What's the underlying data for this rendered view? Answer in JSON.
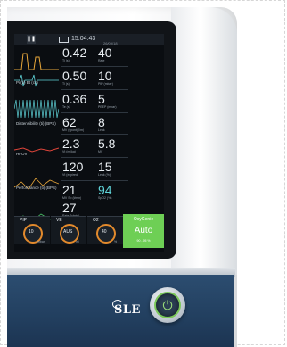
{
  "device": {
    "logo_text": "SLE",
    "power_icon": "power-icon"
  },
  "status_bar": {
    "clock": "15:04:43",
    "date": "26/09/18"
  },
  "wave_labels": [
    "Pi  (ti)  Bt  (cc)",
    "Distensibility  (ti)  (BPS)",
    "HFOV",
    "Performance  (ti)  (BPS)"
  ],
  "readings": [
    {
      "value_a": "0.42",
      "value_b": "40",
      "label_a": "Ti (s)",
      "label_b": "Rate"
    },
    {
      "value_a": "0.50",
      "value_b": "10",
      "label_a": "Ti (s)",
      "label_b": "PIP (mbar)"
    },
    {
      "value_a": "0.36",
      "value_b": "5",
      "label_a": "Te (s)",
      "label_b": "PEEP (mbar)"
    },
    {
      "value_a": "62",
      "value_b": "8",
      "label_a": "MV (spont)(l/m)",
      "label_b": "Leak"
    },
    {
      "value_a": "2.3",
      "value_b": "5.8",
      "label_a": "Vt (ml/kg)",
      "label_b": "MV"
    },
    {
      "value_a": "120",
      "value_b": "15",
      "label_a": "Vt (expired)",
      "label_b": "Leak (%)"
    },
    {
      "value_a": "21",
      "value_b": "94",
      "label_a": "MV Sp (l/min)",
      "label_b": "SpO2 (%)"
    },
    {
      "value_a": "27",
      "value_b": "",
      "label_a": "Rate (b/min)",
      "label_b": ""
    }
  ],
  "params": [
    {
      "label": "PIP",
      "value": "10",
      "foot": "mbar"
    },
    {
      "label": "VE",
      "value": "AUS",
      "foot": "ml"
    },
    {
      "label": "O2",
      "value": "40",
      "foot": "%"
    }
  ],
  "mode_panel": {
    "title": "OxyGenie",
    "value": "Auto",
    "range": "90 - 95 %"
  },
  "colors": {
    "accent_green": "#6ecf55",
    "knob_orange": "#e38a2c",
    "housing_blue": "#223f5f",
    "screen_bg": "#0a0d11"
  }
}
